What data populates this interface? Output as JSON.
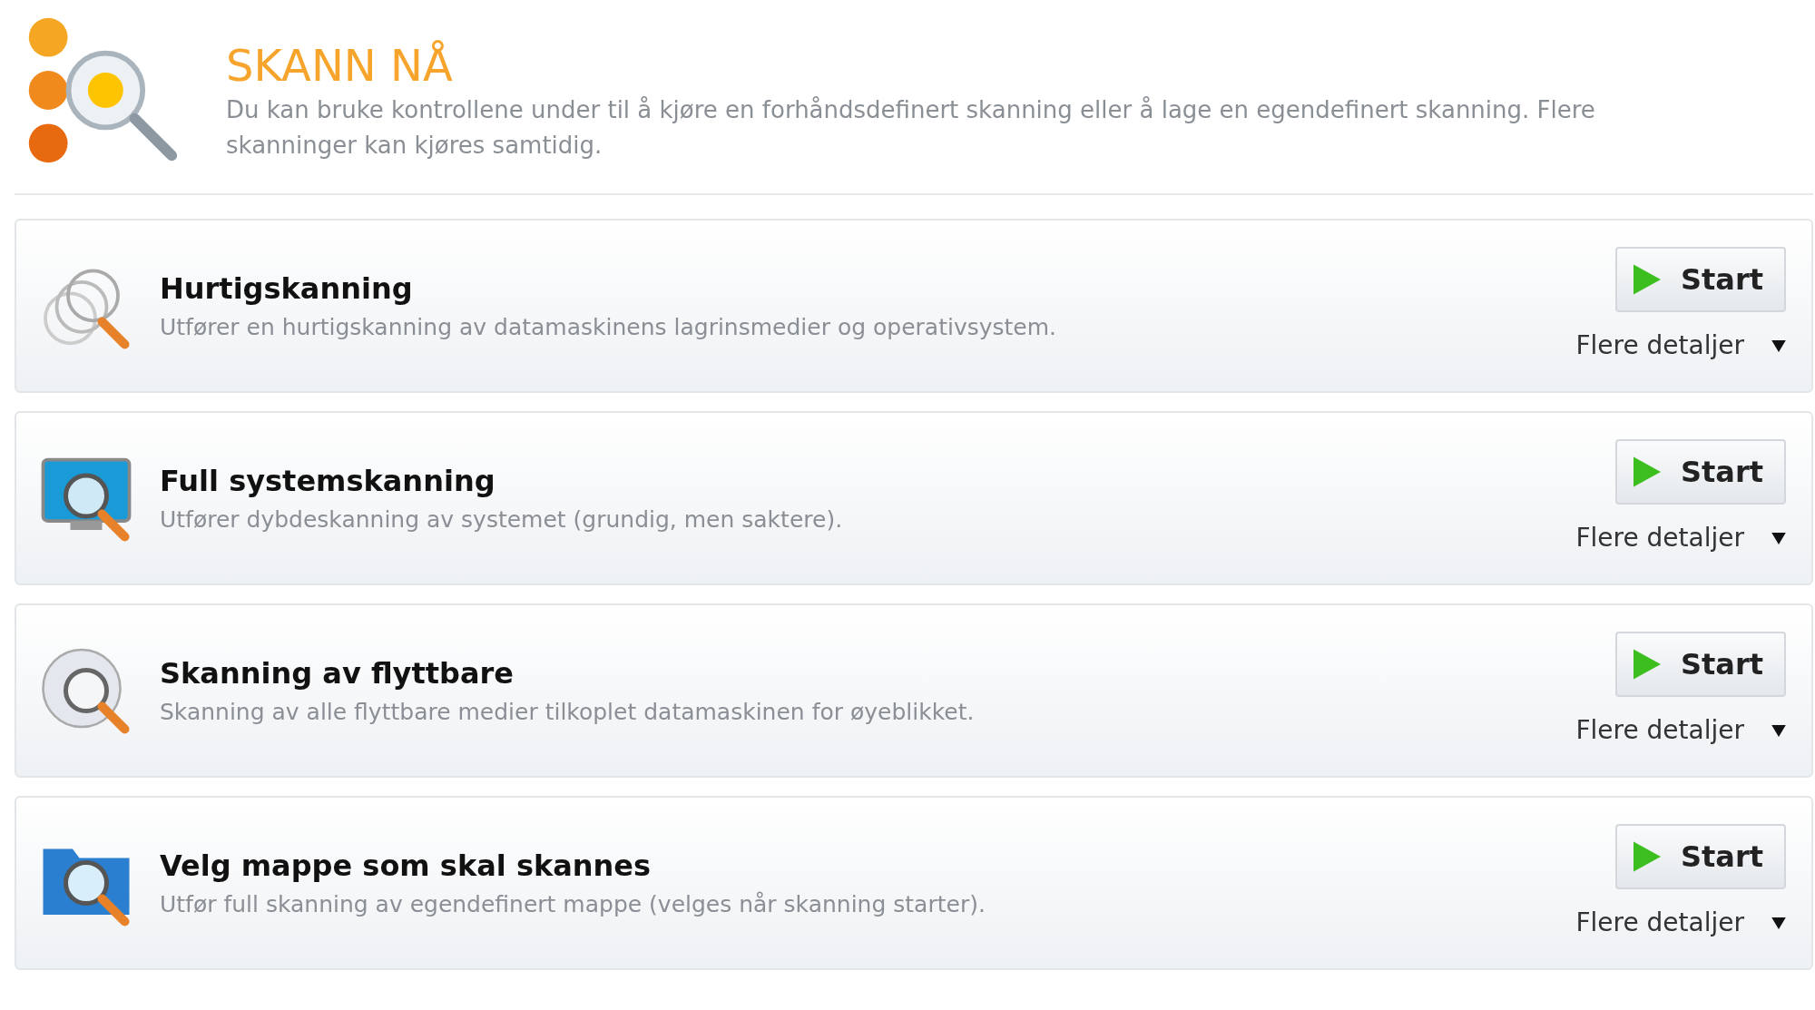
{
  "header": {
    "title": "SKANN NÅ",
    "description": "Du kan bruke kontrollene under til å kjøre en forhåndsdefinert skanning eller å lage en egendefinert skanning. Flere skanninger kan kjøres samtidig."
  },
  "scans": [
    {
      "kind": "quick",
      "title": "Hurtigskanning",
      "description": "Utfører en hurtigskanning av datamaskinens lagrinsmedier og operativsystem.",
      "button": "Start",
      "details": "Flere detaljer"
    },
    {
      "kind": "full",
      "title": "Full systemskanning",
      "description": "Utfører dybdeskanning av systemet (grundig, men saktere).",
      "button": "Start",
      "details": "Flere detaljer"
    },
    {
      "kind": "removable",
      "title": "Skanning av flyttbare",
      "description": "Skanning av alle flyttbare medier tilkoplet datamaskinen for øyeblikket.",
      "button": "Start",
      "details": "Flere detaljer"
    },
    {
      "kind": "folder",
      "title": "Velg mappe som skal skannes",
      "description": "Utfør full skanning av egendefinert mappe (velges når skanning starter).",
      "button": "Start",
      "details": "Flere detaljer"
    }
  ]
}
